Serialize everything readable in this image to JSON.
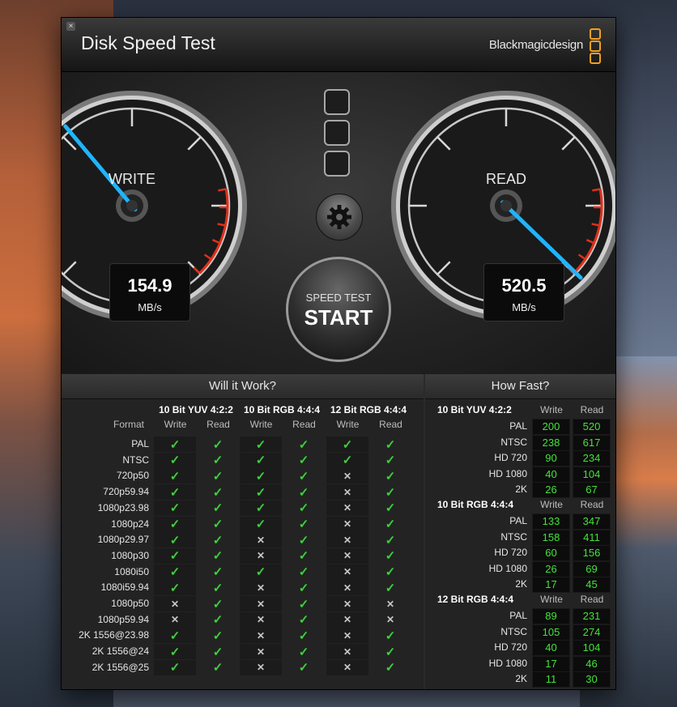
{
  "window": {
    "title": "Disk Speed Test",
    "brand": "Blackmagicdesign",
    "close_glyph": "×"
  },
  "gauges": {
    "write": {
      "label": "WRITE",
      "value": "154.9",
      "unit": "MB/s"
    },
    "read": {
      "label": "READ",
      "value": "520.5",
      "unit": "MB/s"
    }
  },
  "start_button": {
    "small": "SPEED TEST",
    "big": "START"
  },
  "will_it_work": {
    "title": "Will it Work?",
    "groups": [
      "10 Bit YUV 4:2:2",
      "10 Bit RGB 4:4:4",
      "12 Bit RGB 4:4:4"
    ],
    "write_label": "Write",
    "read_label": "Read",
    "format_label": "Format",
    "rows": [
      {
        "name": "PAL",
        "vals": [
          1,
          1,
          1,
          1,
          1,
          1
        ]
      },
      {
        "name": "NTSC",
        "vals": [
          1,
          1,
          1,
          1,
          1,
          1
        ]
      },
      {
        "name": "720p50",
        "vals": [
          1,
          1,
          1,
          1,
          0,
          1
        ]
      },
      {
        "name": "720p59.94",
        "vals": [
          1,
          1,
          1,
          1,
          0,
          1
        ]
      },
      {
        "name": "1080p23.98",
        "vals": [
          1,
          1,
          1,
          1,
          0,
          1
        ]
      },
      {
        "name": "1080p24",
        "vals": [
          1,
          1,
          1,
          1,
          0,
          1
        ]
      },
      {
        "name": "1080p29.97",
        "vals": [
          1,
          1,
          0,
          1,
          0,
          1
        ]
      },
      {
        "name": "1080p30",
        "vals": [
          1,
          1,
          0,
          1,
          0,
          1
        ]
      },
      {
        "name": "1080i50",
        "vals": [
          1,
          1,
          1,
          1,
          0,
          1
        ]
      },
      {
        "name": "1080i59.94",
        "vals": [
          1,
          1,
          0,
          1,
          0,
          1
        ]
      },
      {
        "name": "1080p50",
        "vals": [
          0,
          1,
          0,
          1,
          0,
          0
        ]
      },
      {
        "name": "1080p59.94",
        "vals": [
          0,
          1,
          0,
          1,
          0,
          0
        ]
      },
      {
        "name": "2K 1556@23.98",
        "vals": [
          1,
          1,
          0,
          1,
          0,
          1
        ]
      },
      {
        "name": "2K 1556@24",
        "vals": [
          1,
          1,
          0,
          1,
          0,
          1
        ]
      },
      {
        "name": "2K 1556@25",
        "vals": [
          1,
          1,
          0,
          1,
          0,
          1
        ]
      }
    ]
  },
  "how_fast": {
    "title": "How Fast?",
    "write_label": "Write",
    "read_label": "Read",
    "sections": [
      {
        "name": "10 Bit YUV 4:2:2",
        "rows": [
          {
            "name": "PAL",
            "write": "200",
            "read": "520"
          },
          {
            "name": "NTSC",
            "write": "238",
            "read": "617"
          },
          {
            "name": "HD 720",
            "write": "90",
            "read": "234"
          },
          {
            "name": "HD 1080",
            "write": "40",
            "read": "104"
          },
          {
            "name": "2K",
            "write": "26",
            "read": "67"
          }
        ]
      },
      {
        "name": "10 Bit RGB 4:4:4",
        "rows": [
          {
            "name": "PAL",
            "write": "133",
            "read": "347"
          },
          {
            "name": "NTSC",
            "write": "158",
            "read": "411"
          },
          {
            "name": "HD 720",
            "write": "60",
            "read": "156"
          },
          {
            "name": "HD 1080",
            "write": "26",
            "read": "69"
          },
          {
            "name": "2K",
            "write": "17",
            "read": "45"
          }
        ]
      },
      {
        "name": "12 Bit RGB 4:4:4",
        "rows": [
          {
            "name": "PAL",
            "write": "89",
            "read": "231"
          },
          {
            "name": "NTSC",
            "write": "105",
            "read": "274"
          },
          {
            "name": "HD 720",
            "write": "40",
            "read": "104"
          },
          {
            "name": "HD 1080",
            "write": "17",
            "read": "46"
          },
          {
            "name": "2K",
            "write": "11",
            "read": "30"
          }
        ]
      }
    ]
  },
  "colors": {
    "accent_needle": "#1fb4ff",
    "value_green": "#44e23a",
    "redline": "#e0301a",
    "check_green": "#3ecf3e"
  }
}
